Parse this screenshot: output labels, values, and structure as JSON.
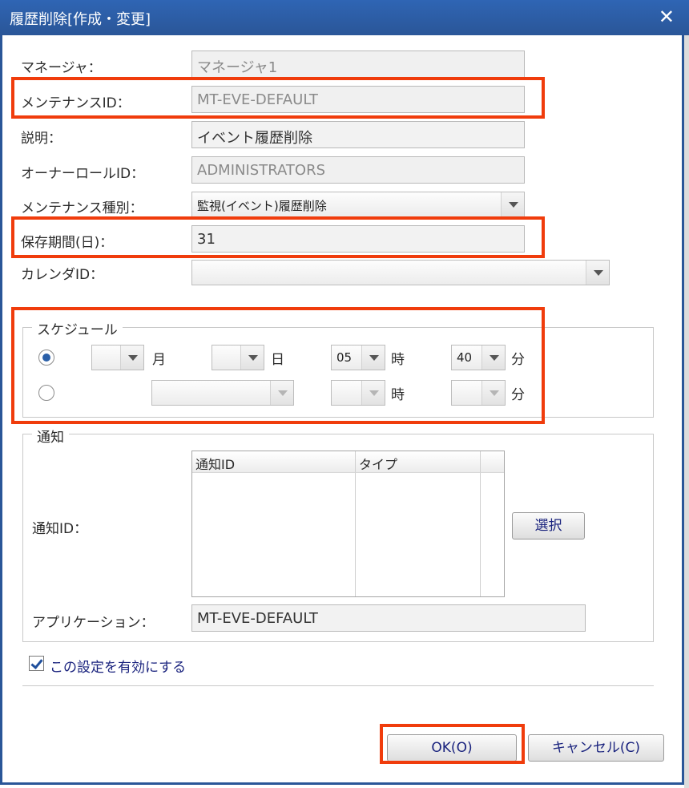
{
  "window": {
    "title": "履歴削除[作成・変更]",
    "close_glyph": "✕"
  },
  "form": {
    "manager_label": "マネージャ：",
    "manager_value": "マネージャ1",
    "maintenance_id_label": "メンテナンスID：",
    "maintenance_id_value": "MT-EVE-DEFAULT",
    "description_label": "説明：",
    "description_value": "イベント履歴削除",
    "owner_role_label": "オーナーロールID：",
    "owner_role_value": "ADMINISTRATORS",
    "maintenance_type_label": "メンテナンス種別：",
    "maintenance_type_value": "監視(イベント)履歴削除",
    "retention_label": "保存期間(日)：",
    "retention_value": "31",
    "calendar_label": "カレンダID：",
    "calendar_value": ""
  },
  "schedule": {
    "title": "スケジュール",
    "row1": {
      "month_value": "",
      "month_unit": "月",
      "day_value": "",
      "day_unit": "日",
      "hour_value": "05",
      "hour_unit": "時",
      "minute_value": "40",
      "minute_unit": "分",
      "selected": true
    },
    "row2": {
      "weekday_value": "",
      "hour_value": "",
      "hour_unit": "時",
      "minute_value": "",
      "minute_unit": "分",
      "selected": false
    }
  },
  "notify": {
    "title": "通知",
    "notify_id_label": "通知ID：",
    "columns": [
      "通知ID",
      "タイプ",
      ""
    ],
    "rows": [],
    "select_button": "選択",
    "application_label": "アプリケーション：",
    "application_value": "MT-EVE-DEFAULT"
  },
  "enable_checkbox": {
    "label": "この設定を有効にする",
    "checked": true
  },
  "buttons": {
    "ok": "OK(O)",
    "cancel": "キャンセル(C)"
  },
  "colors": {
    "titlebar": "#2a5698",
    "highlight": "#f03c0c",
    "button_text": "#1a237e"
  }
}
